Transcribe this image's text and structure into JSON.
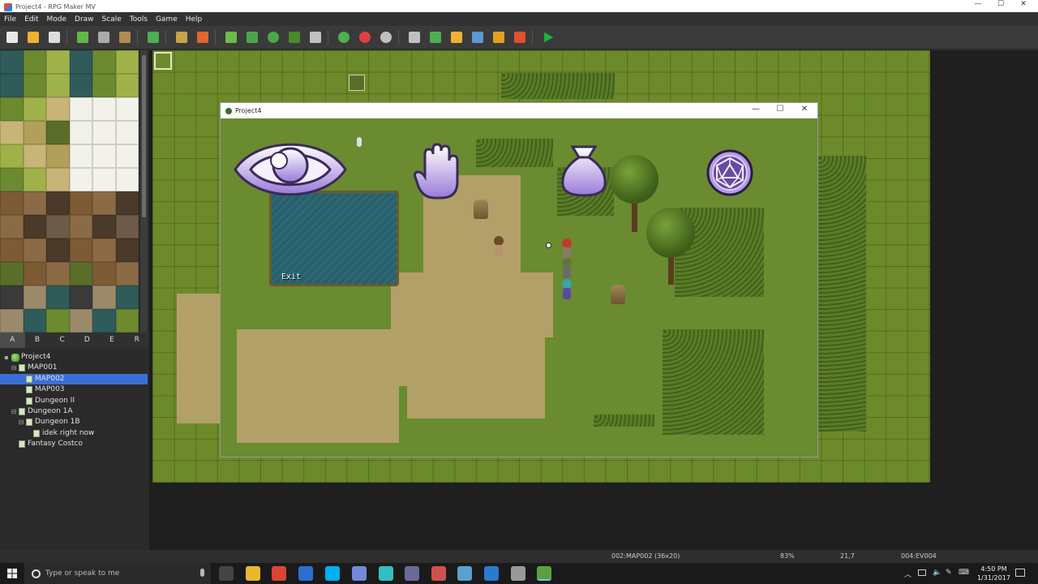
{
  "window": {
    "title": "Project4 - RPG Maker MV",
    "controls": {
      "minimize": "—",
      "maximize": "☐",
      "close": "✕"
    }
  },
  "menu": [
    "File",
    "Edit",
    "Mode",
    "Draw",
    "Scale",
    "Tools",
    "Game",
    "Help"
  ],
  "toolbar": {
    "icons": [
      "new-project-icon",
      "open-project-icon",
      "save-project-icon",
      "sep",
      "cut-icon",
      "copy-icon",
      "paste-icon",
      "sep",
      "undo-icon",
      "sep",
      "map-mode-icon",
      "event-mode-icon",
      "sep",
      "pencil-icon",
      "rectangle-icon",
      "ellipse-icon",
      "fill-icon",
      "shadow-pen-icon",
      "sep",
      "zoom-in-icon",
      "zoom-out-icon",
      "zoom-actual-icon",
      "sep",
      "database-icon",
      "plugin-manager-icon",
      "sound-test-icon",
      "event-searcher-icon",
      "resource-manager-icon",
      "character-generator-icon",
      "sep",
      "playtest-icon"
    ]
  },
  "tileset_tabs": [
    "A",
    "B",
    "C",
    "D",
    "E",
    "R"
  ],
  "tileset_selected_tab": "A",
  "map_tree": [
    {
      "label": "Project4",
      "level": 0,
      "kind": "project",
      "expander": "▪",
      "selected": false
    },
    {
      "label": "MAP001",
      "level": 1,
      "kind": "map",
      "expander": "⊟",
      "selected": false
    },
    {
      "label": "MAP002",
      "level": 2,
      "kind": "map",
      "expander": "",
      "selected": true
    },
    {
      "label": "MAP003",
      "level": 2,
      "kind": "map",
      "expander": "",
      "selected": false
    },
    {
      "label": "Dungeon II",
      "level": 2,
      "kind": "map",
      "expander": "",
      "selected": false
    },
    {
      "label": "Dungeon 1A",
      "level": 1,
      "kind": "map",
      "expander": "⊟",
      "selected": false
    },
    {
      "label": "Dungeon 1B",
      "level": 2,
      "kind": "map",
      "expander": "⊟",
      "selected": false
    },
    {
      "label": "idek right now",
      "level": 3,
      "kind": "map",
      "expander": "",
      "selected": false
    },
    {
      "label": "Fantasy Costco",
      "level": 1,
      "kind": "map",
      "expander": "",
      "selected": false
    }
  ],
  "game_window": {
    "title": "Project4",
    "controls": {
      "minimize": "—",
      "maximize": "☐",
      "close": "✕"
    },
    "command_icons": [
      "eye-icon",
      "hand-icon",
      "bag-icon",
      "d20-icon"
    ],
    "exit_label": "Exit"
  },
  "status": {
    "map": "002:MAP002 (36x20)",
    "zoom": "83%",
    "coords": "21,7",
    "event": "004:EV004"
  },
  "taskbar": {
    "search_placeholder": "Type or speak to me",
    "time": "4:50 PM",
    "date": "1/31/2017"
  },
  "colors": {
    "grass": "#6d8a2a",
    "dirt": "#b3a068",
    "water": "#26606c",
    "icon_purple": "#b79be6",
    "selection": "#3a6fd8"
  }
}
